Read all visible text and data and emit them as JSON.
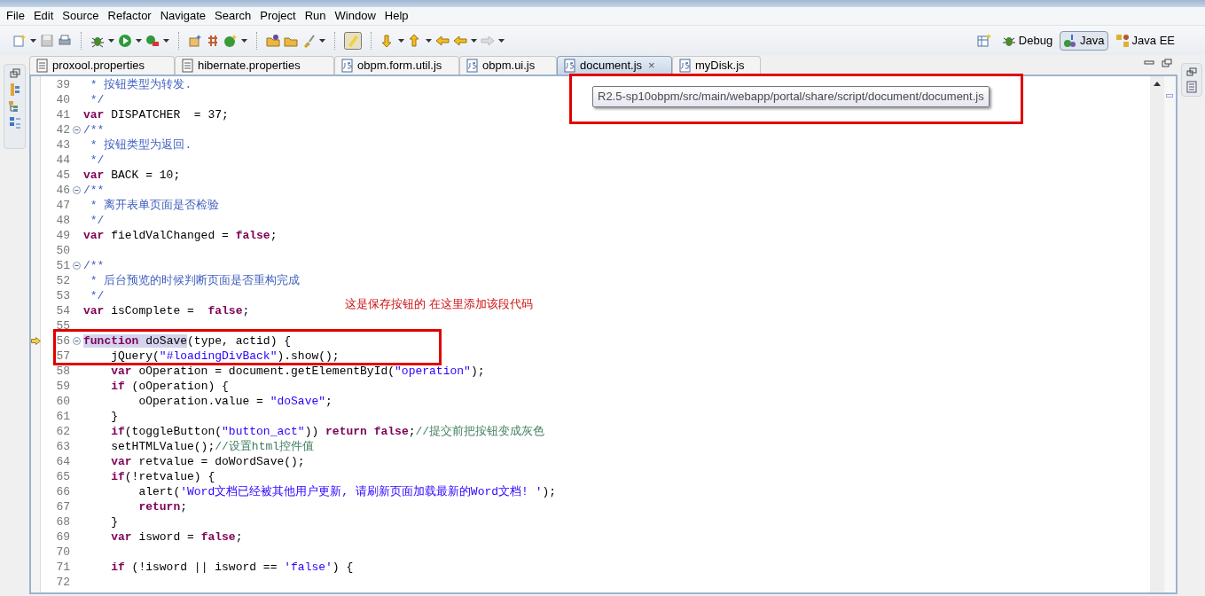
{
  "menu": [
    "File",
    "Edit",
    "Source",
    "Refactor",
    "Navigate",
    "Search",
    "Project",
    "Run",
    "Window",
    "Help"
  ],
  "perspectives": [
    {
      "label": "Debug",
      "kind": "debug",
      "selected": false
    },
    {
      "label": "Java",
      "kind": "java",
      "selected": true
    },
    {
      "label": "Java EE",
      "kind": "javaee",
      "selected": false
    }
  ],
  "tabs": [
    {
      "label": "proxool.properties",
      "kind": "properties",
      "selected": false
    },
    {
      "label": "hibernate.properties",
      "kind": "properties",
      "selected": false
    },
    {
      "label": "obpm.form.util.js",
      "kind": "js",
      "selected": false
    },
    {
      "label": "obpm.ui.js",
      "kind": "js",
      "selected": false
    },
    {
      "label": "document.js",
      "kind": "js",
      "selected": true,
      "close": "×"
    },
    {
      "label": "myDisk.js",
      "kind": "js",
      "selected": false
    }
  ],
  "tooltip": "R2.5-sp10obpm/src/main/webapp/portal/share/script/document/document.js",
  "annotation": {
    "note": "这是保存按钮的 在这里添加该段代码"
  },
  "lines": [
    {
      "number": "39",
      "fold": false,
      "marker": false,
      "tokens": [
        {
          "kind": "doc",
          "text": " * 按钮类型为转发."
        }
      ]
    },
    {
      "number": "40",
      "fold": false,
      "marker": false,
      "tokens": [
        {
          "kind": "doc",
          "text": " */"
        }
      ]
    },
    {
      "number": "41",
      "fold": false,
      "marker": false,
      "tokens": [
        {
          "kind": "kw",
          "text": "var"
        },
        {
          "kind": "plain",
          "text": " DISPATCHER  = 37;"
        }
      ]
    },
    {
      "number": "42",
      "fold": true,
      "marker": false,
      "tokens": [
        {
          "kind": "doc",
          "text": "/**"
        }
      ]
    },
    {
      "number": "43",
      "fold": false,
      "marker": false,
      "tokens": [
        {
          "kind": "doc",
          "text": " * 按钮类型为返回."
        }
      ]
    },
    {
      "number": "44",
      "fold": false,
      "marker": false,
      "tokens": [
        {
          "kind": "doc",
          "text": " */"
        }
      ]
    },
    {
      "number": "45",
      "fold": false,
      "marker": false,
      "tokens": [
        {
          "kind": "kw",
          "text": "var"
        },
        {
          "kind": "plain",
          "text": " BACK = 10;"
        }
      ]
    },
    {
      "number": "46",
      "fold": true,
      "marker": false,
      "tokens": [
        {
          "kind": "doc",
          "text": "/**"
        }
      ]
    },
    {
      "number": "47",
      "fold": false,
      "marker": false,
      "tokens": [
        {
          "kind": "doc",
          "text": " * 离开表单页面是否检验"
        }
      ]
    },
    {
      "number": "48",
      "fold": false,
      "marker": false,
      "tokens": [
        {
          "kind": "doc",
          "text": " */"
        }
      ]
    },
    {
      "number": "49",
      "fold": false,
      "marker": false,
      "tokens": [
        {
          "kind": "kw",
          "text": "var"
        },
        {
          "kind": "plain",
          "text": " fieldValChanged = "
        },
        {
          "kind": "kw",
          "text": "false"
        },
        {
          "kind": "plain",
          "text": ";"
        }
      ]
    },
    {
      "number": "50",
      "fold": false,
      "marker": false
    },
    {
      "number": "51",
      "fold": true,
      "marker": false,
      "tokens": [
        {
          "kind": "doc",
          "text": "/**"
        }
      ]
    },
    {
      "number": "52",
      "fold": false,
      "marker": false,
      "tokens": [
        {
          "kind": "doc",
          "text": " * 后台预览的时候判断页面是否重构完成"
        }
      ]
    },
    {
      "number": "53",
      "fold": false,
      "marker": false,
      "tokens": [
        {
          "kind": "doc",
          "text": " */"
        }
      ]
    },
    {
      "number": "54",
      "fold": false,
      "marker": false,
      "tokens": [
        {
          "kind": "kw",
          "text": "var"
        },
        {
          "kind": "plain",
          "text": " isComplete =  "
        },
        {
          "kind": "kw",
          "text": "false"
        },
        {
          "kind": "plain",
          "text": ";"
        }
      ]
    },
    {
      "number": "55",
      "fold": false,
      "marker": false
    },
    {
      "number": "56",
      "fold": true,
      "marker": true,
      "tokens": [
        {
          "kind": "kw",
          "text": "function",
          "marked": true
        },
        {
          "kind": "plain",
          "text": " doSave",
          "marked": true
        },
        {
          "kind": "plain",
          "text": "(type, actid) {"
        }
      ]
    },
    {
      "number": "57",
      "fold": false,
      "marker": false,
      "tokens": [
        {
          "kind": "plain",
          "text": "    jQuery("
        },
        {
          "kind": "str",
          "text": "\"#loadingDivBack\""
        },
        {
          "kind": "plain",
          "text": ").show();"
        }
      ]
    },
    {
      "number": "58",
      "fold": false,
      "marker": false,
      "tokens": [
        {
          "kind": "kw",
          "text": "    var"
        },
        {
          "kind": "plain",
          "text": " oOperation = document.getElementById("
        },
        {
          "kind": "str",
          "text": "\"operation\""
        },
        {
          "kind": "plain",
          "text": ");"
        }
      ]
    },
    {
      "number": "59",
      "fold": false,
      "marker": false,
      "tokens": [
        {
          "kind": "kw",
          "text": "    if"
        },
        {
          "kind": "plain",
          "text": " (oOperation) {"
        }
      ]
    },
    {
      "number": "60",
      "fold": false,
      "marker": false,
      "tokens": [
        {
          "kind": "plain",
          "text": "        oOperation.value = "
        },
        {
          "kind": "str",
          "text": "\"doSave\""
        },
        {
          "kind": "plain",
          "text": ";"
        }
      ]
    },
    {
      "number": "61",
      "fold": false,
      "marker": false,
      "tokens": [
        {
          "kind": "plain",
          "text": "    }"
        }
      ]
    },
    {
      "number": "62",
      "fold": false,
      "marker": false,
      "tokens": [
        {
          "kind": "kw",
          "text": "    if"
        },
        {
          "kind": "plain",
          "text": "(toggleButton("
        },
        {
          "kind": "str",
          "text": "\"button_act\""
        },
        {
          "kind": "plain",
          "text": ")) "
        },
        {
          "kind": "kw",
          "text": "return false"
        },
        {
          "kind": "plain",
          "text": ";"
        },
        {
          "kind": "comment",
          "text": "//提交前把按钮变成灰色"
        }
      ]
    },
    {
      "number": "63",
      "fold": false,
      "marker": false,
      "tokens": [
        {
          "kind": "plain",
          "text": "    setHTMLValue();"
        },
        {
          "kind": "comment",
          "text": "//设置html控件值"
        }
      ]
    },
    {
      "number": "64",
      "fold": false,
      "marker": false,
      "tokens": [
        {
          "kind": "kw",
          "text": "    var"
        },
        {
          "kind": "plain",
          "text": " retvalue = doWordSave();"
        }
      ]
    },
    {
      "number": "65",
      "fold": false,
      "marker": false,
      "tokens": [
        {
          "kind": "kw",
          "text": "    if"
        },
        {
          "kind": "plain",
          "text": "(!retvalue) {"
        }
      ]
    },
    {
      "number": "66",
      "fold": false,
      "marker": false,
      "tokens": [
        {
          "kind": "plain",
          "text": "        alert("
        },
        {
          "kind": "str",
          "text": "'Word文档已经被其他用户更新, 请刷新页面加载最新的Word文档! '"
        },
        {
          "kind": "plain",
          "text": ");"
        }
      ]
    },
    {
      "number": "67",
      "fold": false,
      "marker": false,
      "tokens": [
        {
          "kind": "kw",
          "text": "        return"
        },
        {
          "kind": "plain",
          "text": ";"
        }
      ]
    },
    {
      "number": "68",
      "fold": false,
      "marker": false,
      "tokens": [
        {
          "kind": "plain",
          "text": "    }"
        }
      ]
    },
    {
      "number": "69",
      "fold": false,
      "marker": false,
      "tokens": [
        {
          "kind": "kw",
          "text": "    var"
        },
        {
          "kind": "plain",
          "text": " isword = "
        },
        {
          "kind": "kw",
          "text": "false"
        },
        {
          "kind": "plain",
          "text": ";"
        }
      ]
    },
    {
      "number": "70",
      "fold": false,
      "marker": false
    },
    {
      "number": "71",
      "fold": false,
      "marker": false,
      "tokens": [
        {
          "kind": "kw",
          "text": "    if"
        },
        {
          "kind": "plain",
          "text": " (!isword || isword == "
        },
        {
          "kind": "str",
          "text": "'false'"
        },
        {
          "kind": "plain",
          "text": ") {"
        }
      ]
    },
    {
      "number": "72",
      "fold": false,
      "marker": false
    }
  ]
}
